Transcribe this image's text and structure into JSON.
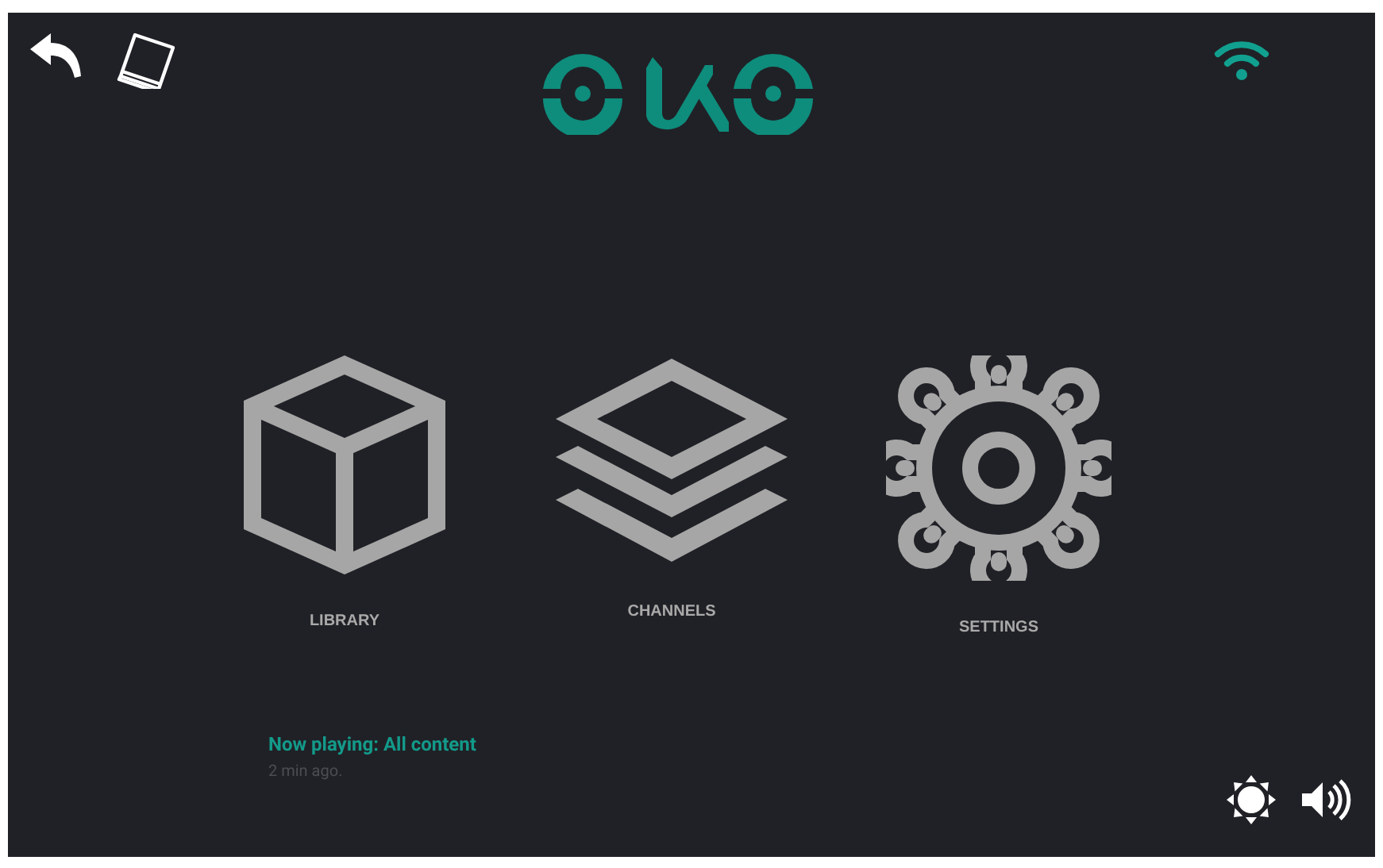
{
  "menu": [
    {
      "kind": "box",
      "label": "LIBRARY"
    },
    {
      "kind": "layers",
      "label": "CHANNELS"
    },
    {
      "kind": "gear",
      "label": "SETTINGS"
    }
  ],
  "now_playing": {
    "title": "Now playing: All content",
    "time": "2 min ago."
  }
}
